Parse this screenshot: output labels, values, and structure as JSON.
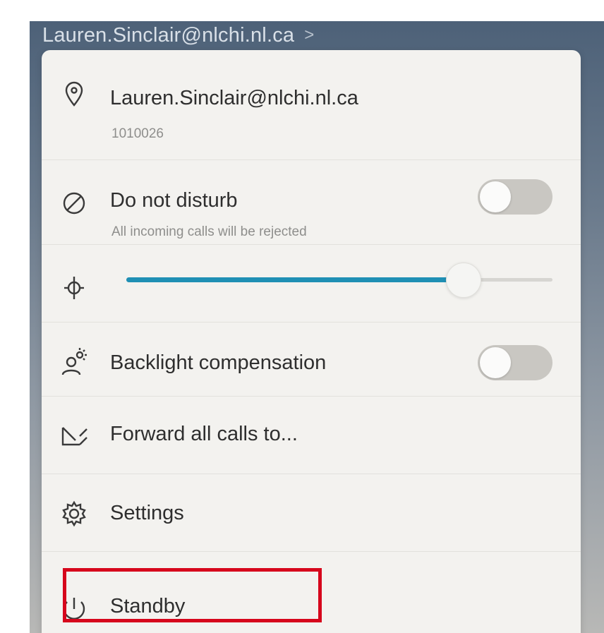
{
  "header": {
    "account": "Lauren.Sinclair@nlchi.nl.ca",
    "chevron": ">"
  },
  "menu": {
    "account": {
      "name": "Lauren.Sinclair@nlchi.nl.ca",
      "number": "1010026",
      "icon": "location-pin-icon"
    },
    "do_not_disturb": {
      "label": "Do not disturb",
      "description": "All incoming calls will be rejected",
      "enabled": false,
      "icon": "do-not-disturb-icon"
    },
    "brightness": {
      "icon": "brightness-icon",
      "level": 0.79
    },
    "backlight": {
      "label": "Backlight compensation",
      "enabled": false,
      "icon": "backlight-person-icon"
    },
    "forward": {
      "label": "Forward all calls to...",
      "icon": "forward-arrow-icon"
    },
    "settings": {
      "label": "Settings",
      "icon": "gear-icon"
    },
    "standby": {
      "label": "Standby",
      "icon": "power-icon"
    }
  },
  "colors": {
    "accent": "#1f8fb4",
    "highlight": "#d6061c"
  }
}
